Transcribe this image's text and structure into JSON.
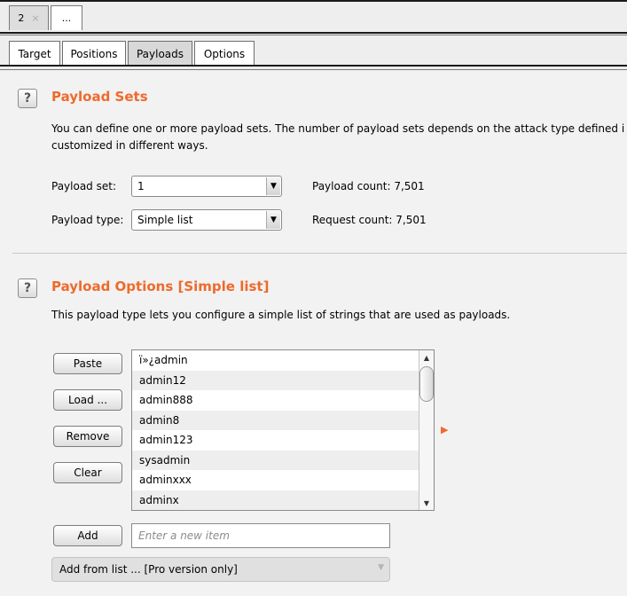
{
  "outer_tabs": [
    {
      "label": "2",
      "close_glyph": "×"
    },
    {
      "label": "..."
    }
  ],
  "inner_tabs": [
    "Target",
    "Positions",
    "Payloads",
    "Options"
  ],
  "payload_sets": {
    "help_glyph": "?",
    "title": "Payload Sets",
    "description_line1": "You can define one or more payload sets. The number of payload sets depends on the attack type defined i",
    "description_line2": "customized in different ways.",
    "payload_set_label": "Payload set:",
    "payload_set_value": "1",
    "payload_count": "Payload count:  7,501",
    "payload_type_label": "Payload type:",
    "payload_type_value": "Simple list",
    "request_count": "Request count:  7,501"
  },
  "payload_options": {
    "help_glyph": "?",
    "title": "Payload Options [Simple list]",
    "description": "This payload type lets you configure a simple list of strings that are used as payloads.",
    "buttons": {
      "paste": "Paste",
      "load": "Load ...",
      "remove": "Remove",
      "clear": "Clear",
      "add": "Add"
    },
    "items": [
      "ï»¿admin",
      "admin12",
      "admin888",
      "admin8",
      "admin123",
      "sysadmin",
      "adminxxx",
      "adminx"
    ],
    "add_placeholder": "Enter a new item",
    "add_from_list": "Add from list ... [Pro version only]"
  },
  "icons": {
    "dropdown": "dropdown-arrow-icon",
    "scroll_up": "scroll-up-arrow-icon",
    "scroll_down": "scroll-down-arrow-icon",
    "pointer": "orange-pointer-icon"
  },
  "colors": {
    "accent": "#ee6a2c"
  }
}
